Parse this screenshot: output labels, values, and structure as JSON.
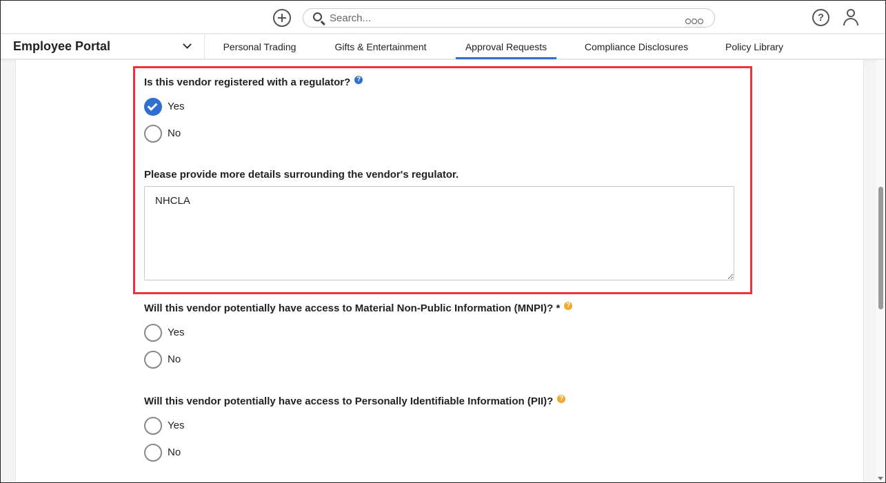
{
  "topbar": {
    "search": {
      "placeholder": "Search..."
    },
    "icons": [
      "add-icon",
      "search-icon",
      "more-options-icon",
      "help-icon",
      "user-icon"
    ]
  },
  "nav": {
    "portal_title": "Employee Portal",
    "tabs": [
      {
        "label": "Personal Trading",
        "active": false
      },
      {
        "label": "Gifts & Entertainment",
        "active": false
      },
      {
        "label": "Approval Requests",
        "active": true
      },
      {
        "label": "Compliance Disclosures",
        "active": false
      },
      {
        "label": "Policy Library",
        "active": false
      }
    ]
  },
  "form": {
    "q_regulator": {
      "label": "Is this vendor registered with a regulator?",
      "hint_icon": "question-blue",
      "options": [
        {
          "label": "Yes",
          "selected": true
        },
        {
          "label": "No",
          "selected": false
        }
      ]
    },
    "q_regulator_details": {
      "label": "Please provide more details surrounding the vendor's regulator.",
      "value": "NHCLA"
    },
    "q_mnpi": {
      "label": "Will this vendor potentially have access to Material Non-Public Information (MNPI)? *",
      "hint_icon": "question-orange",
      "options": [
        {
          "label": "Yes",
          "selected": false
        },
        {
          "label": "No",
          "selected": false
        }
      ]
    },
    "q_pii": {
      "label": "Will this vendor potentially have access to Personally Identifiable Information (PII)?",
      "hint_icon": "question-orange",
      "options": [
        {
          "label": "Yes",
          "selected": false
        },
        {
          "label": "No",
          "selected": false
        }
      ]
    }
  },
  "colors": {
    "accent": "#2f6fd0",
    "highlight_border": "#e8323c",
    "hint_orange": "#f1a92c"
  }
}
